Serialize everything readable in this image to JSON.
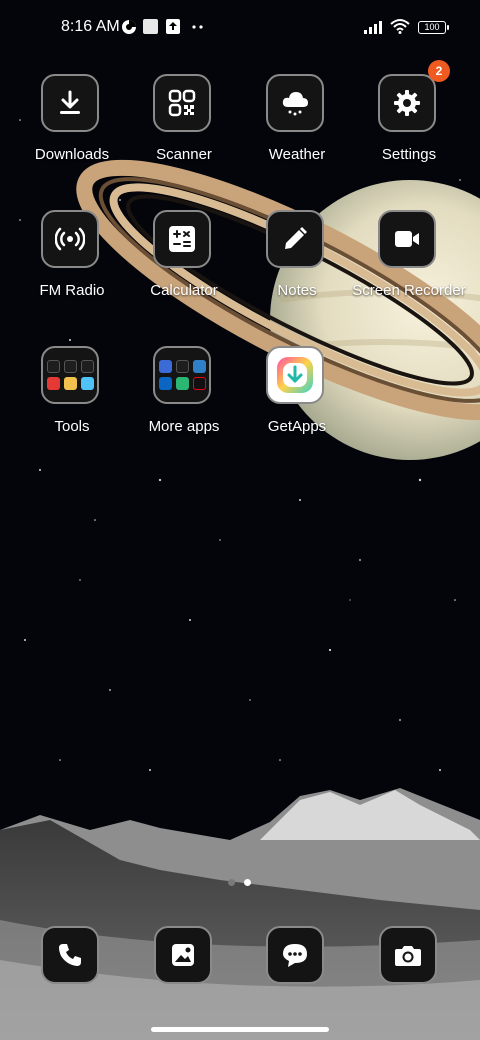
{
  "status_bar": {
    "time": "8:16 AM",
    "battery": "100",
    "icons": [
      "data-saver-icon",
      "notification-square-icon",
      "upload-icon",
      "more-dots-icon",
      "signal-icon",
      "wifi-icon",
      "battery-icon"
    ]
  },
  "apps": [
    {
      "label": "Downloads",
      "icon": "download-icon"
    },
    {
      "label": "Scanner",
      "icon": "qr-scanner-icon"
    },
    {
      "label": "Weather",
      "icon": "weather-cloud-icon"
    },
    {
      "label": "Settings",
      "icon": "gear-icon",
      "badge": "2"
    },
    {
      "label": "FM Radio",
      "icon": "radio-icon"
    },
    {
      "label": "Calculator",
      "icon": "calculator-icon"
    },
    {
      "label": "Notes",
      "icon": "pencil-icon"
    },
    {
      "label": "Screen Recorder",
      "icon": "video-camera-icon"
    },
    {
      "label": "Tools",
      "icon": "folder-icon"
    },
    {
      "label": "More apps",
      "icon": "folder-icon"
    },
    {
      "label": "GetApps",
      "icon": "getapps-icon"
    }
  ],
  "page_indicator": {
    "pages": 2,
    "active": 2
  },
  "dock": [
    {
      "icon": "phone-icon"
    },
    {
      "icon": "gallery-icon"
    },
    {
      "icon": "messages-icon"
    },
    {
      "icon": "camera-icon"
    }
  ],
  "colors": {
    "badge": "#ee5a1f",
    "tile_bg": "#141414",
    "tile_border": "#8a8a8a"
  }
}
